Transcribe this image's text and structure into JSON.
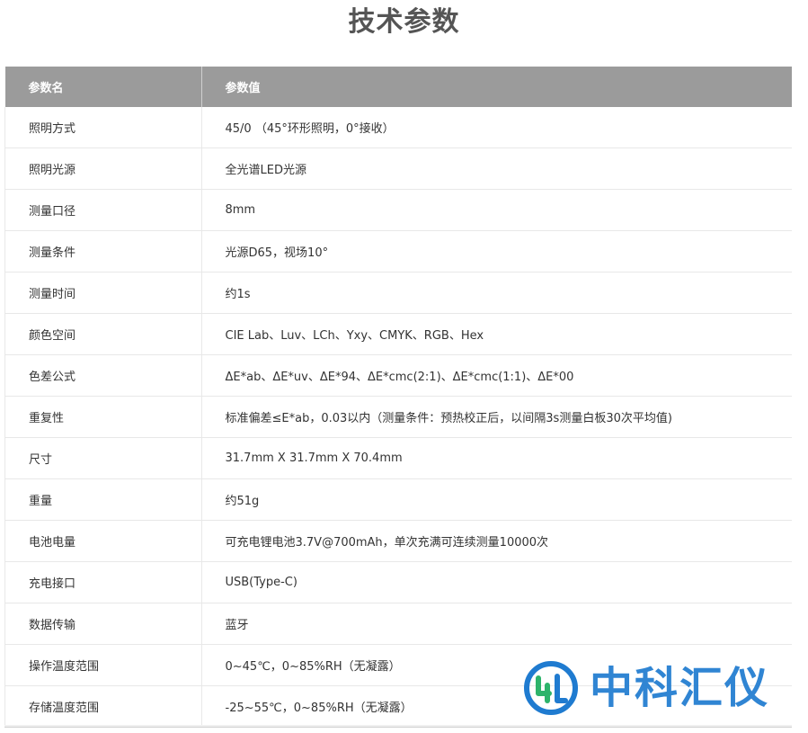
{
  "page": {
    "title": "技术参数"
  },
  "table": {
    "headers": [
      "参数名",
      "参数值"
    ],
    "rows": [
      {
        "name": "照明方式",
        "value": "45/0 （45°环形照明，0°接收）"
      },
      {
        "name": "照明光源",
        "value": "全光谱LED光源"
      },
      {
        "name": "测量口径",
        "value": "8mm"
      },
      {
        "name": "测量条件",
        "value": "光源D65，视场10°"
      },
      {
        "name": "测量时间",
        "value": "约1s"
      },
      {
        "name": "颜色空间",
        "value": "CIE Lab、Luv、LCh、Yxy、CMYK、RGB、Hex"
      },
      {
        "name": "色差公式",
        "value": "ΔE*ab、ΔE*uv、ΔE*94、ΔE*cmc(2:1)、ΔE*cmc(1:1)、ΔE*00"
      },
      {
        "name": "重复性",
        "value": "标准偏差≤E*ab，0.03以内（测量条件：预热校正后，以间隔3s测量白板30次平均值)"
      },
      {
        "name": "尺寸",
        "value": "31.7mm X 31.7mm X 70.4mm"
      },
      {
        "name": "重量",
        "value": "约51g"
      },
      {
        "name": "电池电量",
        "value": "可充电锂电池3.7V@700mAh，单次充满可连续测量10000次"
      },
      {
        "name": "充电接口",
        "value": "USB(Type-C)"
      },
      {
        "name": "数据传输",
        "value": "蓝牙"
      },
      {
        "name": "操作温度范围",
        "value": "0~45℃，0~85%RH（无凝露）"
      },
      {
        "name": "存储温度范围",
        "value": " -25~55℃，0~85%RH（无凝露）"
      }
    ]
  },
  "watermark": {
    "text": "中科汇仪",
    "icon": "company-logo-icon",
    "color": "#1f7bd0",
    "accent": "#2db36b"
  }
}
